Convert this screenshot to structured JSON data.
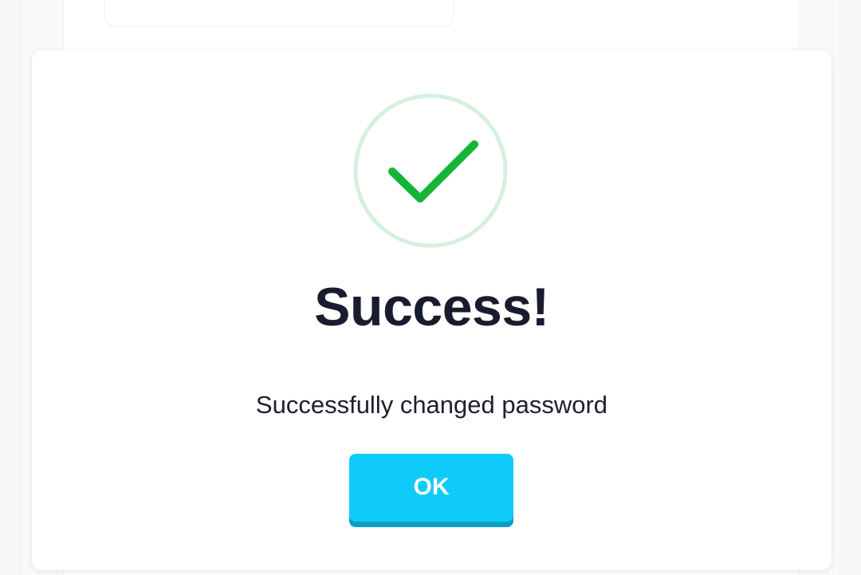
{
  "dialog": {
    "icon": "checkmark-circle-icon",
    "title": "Success!",
    "message": "Successfully changed password",
    "ok_label": "OK"
  },
  "colors": {
    "accent": "#0fcbfa",
    "accent_shadow": "#0b9fc6",
    "success_green": "#14b437",
    "success_ring": "#d4f1dd",
    "title_text": "#191b2e"
  }
}
